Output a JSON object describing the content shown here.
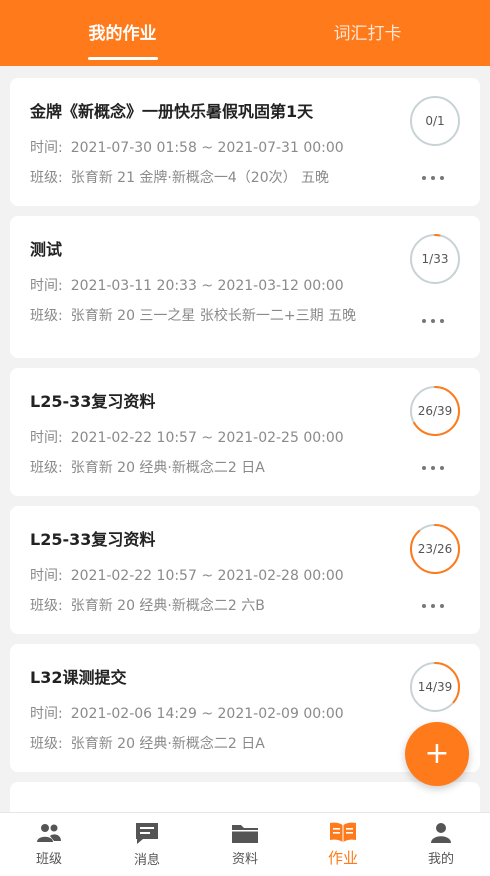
{
  "header": {
    "tabs": [
      {
        "label": "我的作业",
        "active": true
      },
      {
        "label": "词汇打卡",
        "active": false
      }
    ]
  },
  "labels": {
    "time": "时间:",
    "class": "班级:"
  },
  "assignments": [
    {
      "title": "金牌《新概念》一册快乐暑假巩固第1天",
      "time": "2021-07-30 01:58 ~ 2021-07-31 00:00",
      "class": "张育新 21 金牌·新概念一4（20次） 五晚",
      "progress": "0/1",
      "done": 0,
      "total": 1
    },
    {
      "title": "测试",
      "time": "2021-03-11 20:33 ~ 2021-03-12 00:00",
      "class": "张育新 20 三一之星 张校长新一二+三期 五晚",
      "progress": "1/33",
      "done": 1,
      "total": 33
    },
    {
      "title": "L25-33复习资料",
      "time": "2021-02-22 10:57 ~ 2021-02-25 00:00",
      "class": "张育新 20 经典·新概念二2 日A",
      "progress": "26/39",
      "done": 26,
      "total": 39
    },
    {
      "title": "L25-33复习资料",
      "time": "2021-02-22 10:57 ~ 2021-02-28 00:00",
      "class": "张育新 20 经典·新概念二2 六B",
      "progress": "23/26",
      "done": 23,
      "total": 26
    },
    {
      "title": "L32课测提交",
      "time": "2021-02-06 14:29 ~ 2021-02-09 00:00",
      "class": "张育新 20 经典·新概念二2 日A",
      "progress": "14/39",
      "done": 14,
      "total": 39
    }
  ],
  "fab": {
    "label": "+"
  },
  "bottom_nav": {
    "items": [
      {
        "label": "班级",
        "icon": "class-icon",
        "active": false
      },
      {
        "label": "消息",
        "icon": "message-icon",
        "active": false
      },
      {
        "label": "资料",
        "icon": "folder-icon",
        "active": false
      },
      {
        "label": "作业",
        "icon": "homework-book-icon",
        "active": true
      },
      {
        "label": "我的",
        "icon": "profile-icon",
        "active": false
      }
    ]
  },
  "colors": {
    "accent": "#ff7a1a",
    "ring_track": "#c8d3d6",
    "text_secondary": "#8a8a8a"
  }
}
